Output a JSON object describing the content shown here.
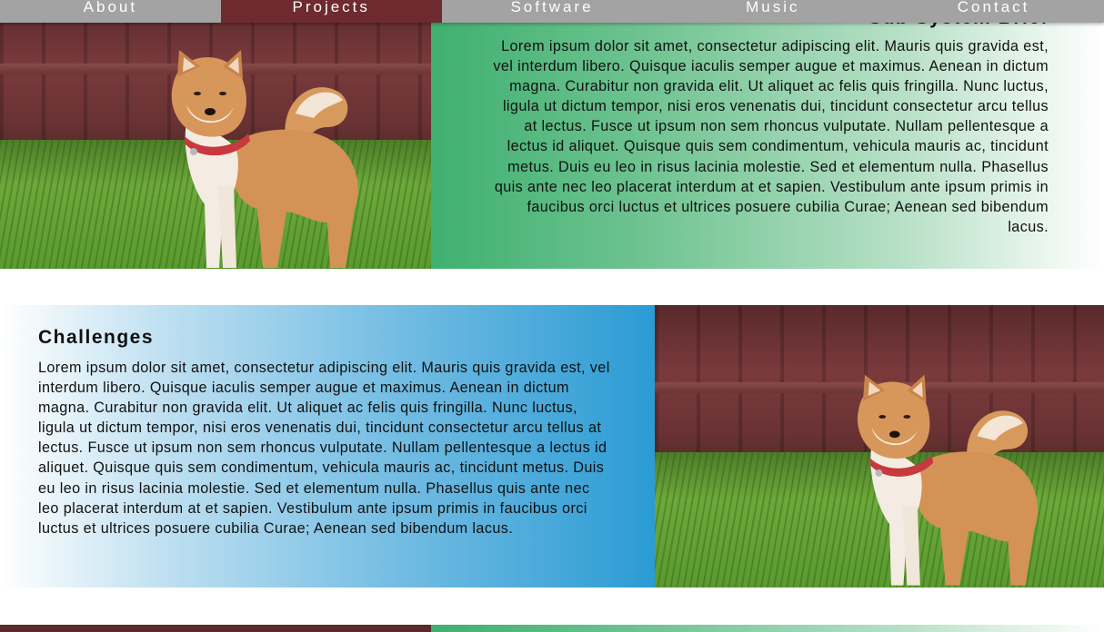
{
  "nav": {
    "items": [
      {
        "label": "About"
      },
      {
        "label": "Projects"
      },
      {
        "label": "Software"
      },
      {
        "label": "Music"
      },
      {
        "label": "Contact"
      }
    ],
    "active_index": 1
  },
  "section1": {
    "title": "Sub System Brief",
    "text": "Lorem ipsum dolor sit amet, consectetur adipiscing elit. Mauris quis gravida est, vel interdum libero. Quisque iaculis semper augue et maximus. Aenean in dictum magna. Curabitur non gravida elit. Ut aliquet ac felis quis fringilla. Nunc luctus, ligula ut dictum tempor, nisi eros venenatis dui, tincidunt consectetur arcu tellus at lectus. Fusce ut ipsum non sem rhoncus vulputate. Nullam pellentesque a lectus id aliquet. Quisque quis sem condimentum, vehicula mauris ac, tincidunt metus. Duis eu leo in risus lacinia molestie. Sed et elementum nulla. Phasellus quis ante nec leo placerat interdum at et sapien. Vestibulum ante ipsum primis in faucibus orci luctus et ultrices posuere cubilia Curae; Aenean sed bibendum lacus."
  },
  "section2": {
    "title": "Challenges",
    "text": "Lorem ipsum dolor sit amet, consectetur adipiscing elit. Mauris quis gravida est, vel interdum libero. Quisque iaculis semper augue et maximus. Aenean in dictum magna. Curabitur non gravida elit. Ut aliquet ac felis quis fringilla. Nunc luctus, ligula ut dictum tempor, nisi eros venenatis dui, tincidunt consectetur arcu tellus at lectus. Fusce ut ipsum non sem rhoncus vulputate. Nullam pellentesque a lectus id aliquet. Quisque quis sem condimentum, vehicula mauris ac, tincidunt metus. Duis eu leo in risus lacinia molestie. Sed et elementum nulla. Phasellus quis ante nec leo placerat interdum at et sapien. Vestibulum ante ipsum primis in faucibus orci luctus et ultrices posuere cubilia Curae; Aenean sed bibendum lacus."
  },
  "colors": {
    "nav_background": "#a3a3a3",
    "nav_active": "#6e2a2e",
    "green_accent": "#3fb06f",
    "blue_accent": "#2b9bd4"
  },
  "images": {
    "photo": "shiba-inu-dog-photo"
  }
}
